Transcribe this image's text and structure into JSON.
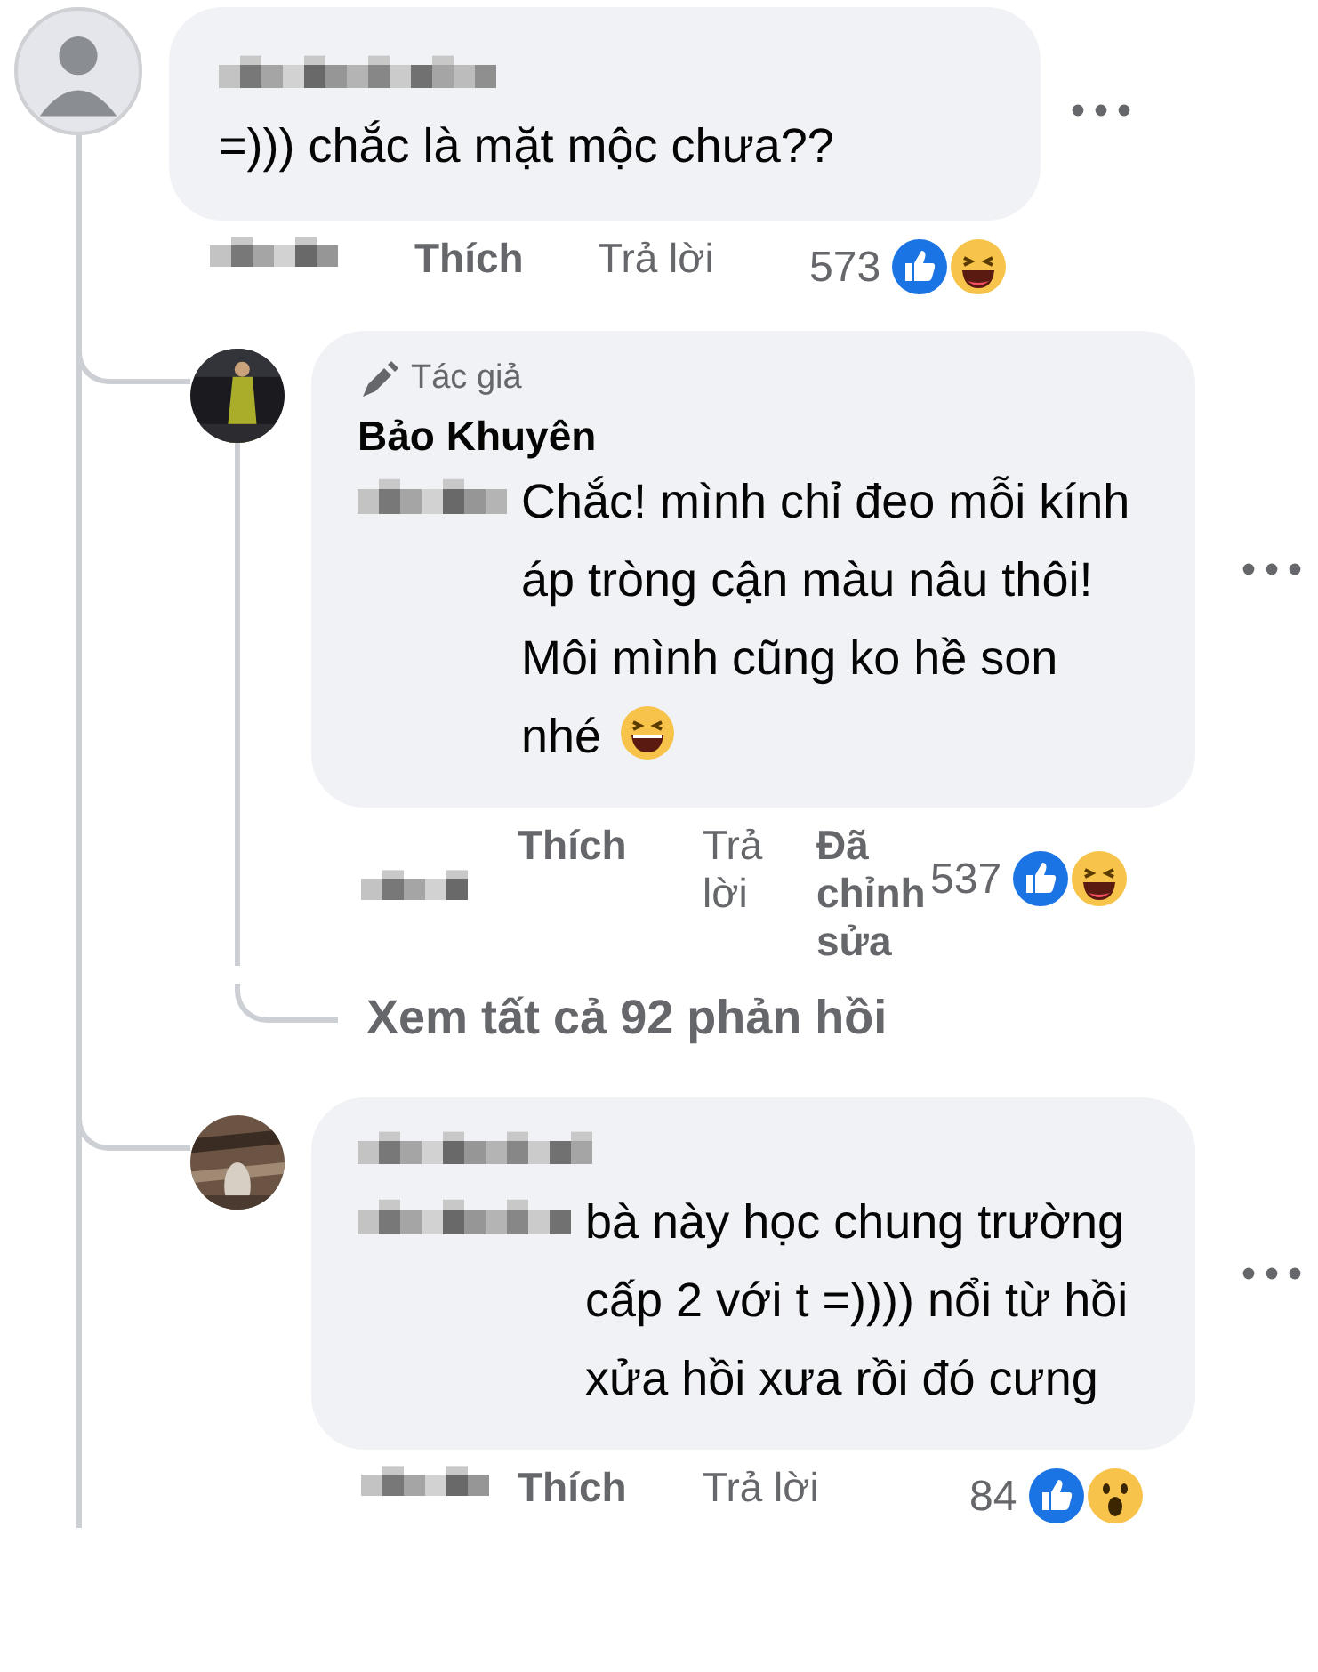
{
  "comments": [
    {
      "avatar": {
        "kind": "silhouette"
      },
      "text": "=))) chắc là mặt mộc chưa??",
      "actions": [
        {
          "kind": "like",
          "label": "Thích"
        },
        {
          "kind": "reply",
          "label": "Trả lời"
        }
      ],
      "reaction_count": "573",
      "reactions": [
        {
          "kind": "like"
        },
        {
          "kind": "haha"
        }
      ],
      "replies": [
        {
          "avatar": {
            "kind": "picture"
          },
          "badge": "Tác giả",
          "author": "Bảo Khuyên",
          "blurred_prefix": true,
          "text": "Chắc! mình chỉ đeo mỗi kính áp tròng cận màu nâu thôi! Môi mình cũng ko hề son nhé",
          "trailing_emoji": {
            "kind": "laughing"
          },
          "actions": [
            {
              "kind": "like",
              "label": "Thích"
            },
            {
              "kind": "reply",
              "label": "Trả lời"
            },
            {
              "kind": "edited",
              "label": "Đã chỉnh sửa"
            }
          ],
          "reaction_count": "537",
          "reactions": [
            {
              "kind": "like"
            },
            {
              "kind": "haha"
            }
          ],
          "view_replies": "Xem tất cả 92 phản hồi"
        },
        {
          "avatar": {
            "kind": "picture"
          },
          "blurred_prefix": true,
          "text": "bà này học chung trường cấp 2 với t =)))) nổi từ hồi xửa hồi xưa rồi đó cưng",
          "actions": [
            {
              "kind": "like",
              "label": "Thích"
            },
            {
              "kind": "reply",
              "label": "Trả lời"
            }
          ],
          "reaction_count": "84",
          "reactions": [
            {
              "kind": "like"
            },
            {
              "kind": "wow"
            }
          ]
        }
      ]
    }
  ]
}
